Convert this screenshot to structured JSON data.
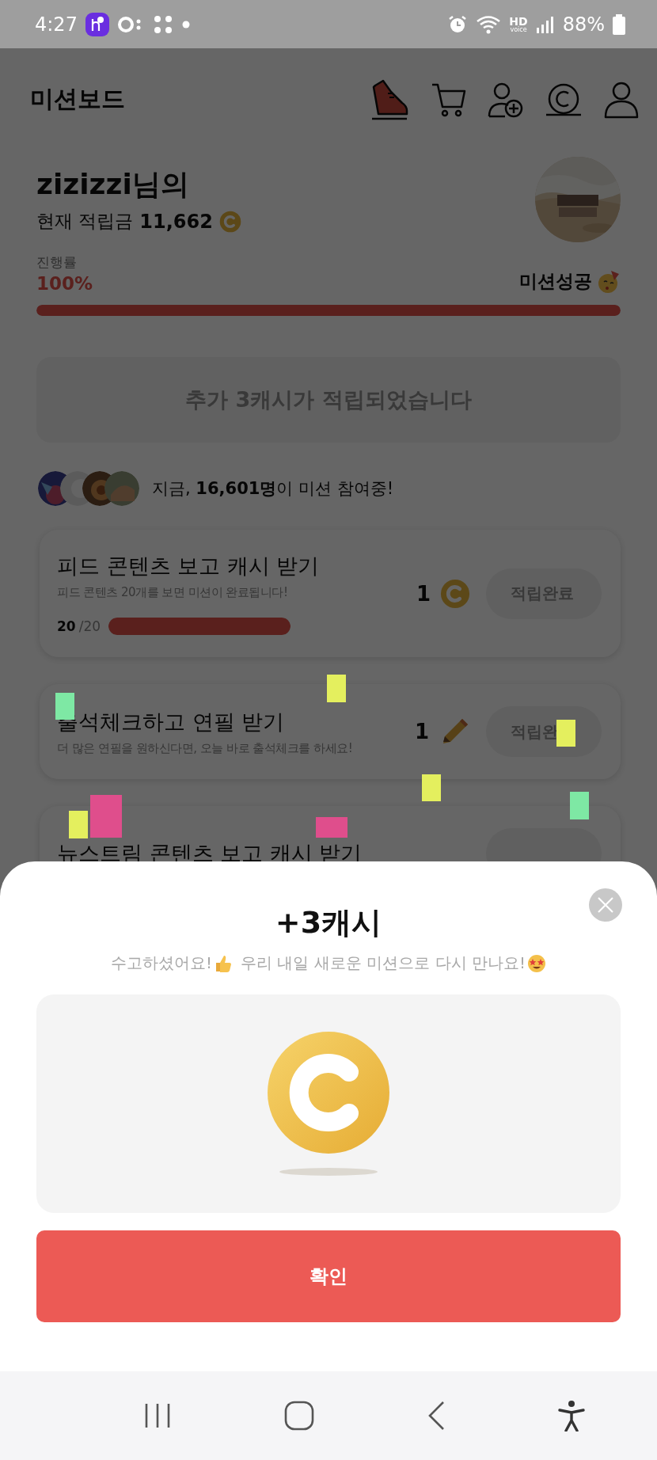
{
  "status_bar": {
    "time": "4:27",
    "network_label": "HD",
    "network_sublabel": "voice",
    "battery": "88%"
  },
  "header": {
    "title": "미션보드"
  },
  "profile": {
    "name": "zizizzi님의",
    "balance_label": "현재 적립금",
    "balance": "11,662"
  },
  "progress": {
    "label": "진행률",
    "percent": "100%",
    "status": "미션성공",
    "level": 1
  },
  "notice": "추가 3캐시가 적립되었습니다",
  "participants": {
    "text": "지금, **16,601명**이 미션 참여중!"
  },
  "missions": [
    {
      "title": "피드 콘텐츠 보고 캐시 받기",
      "description": "피드 콘텐츠 20개를 보면 미션이 완료됩니다!",
      "count_done": "20",
      "count_total": "/20",
      "level": 1,
      "reward": "1",
      "kind": "coin",
      "button": "적립완료",
      "disabled": true
    },
    {
      "title": "출석체크하고 연필 받기",
      "description": "더 많은 연필을 원하신다면, 오늘 바로 출석체크를 하세요!",
      "reward": "1",
      "kind": "pencil",
      "button": "적립완",
      "disabled": true
    },
    {
      "title": "뉴스트림 콘텐츠 보고 캐시 받기"
    }
  ],
  "modal": {
    "title": "+3캐시",
    "message_1": "수고하셨어요!",
    "message_2": "우리 내일 새로운 미션으로 다시 만나요!",
    "button": "확인"
  }
}
